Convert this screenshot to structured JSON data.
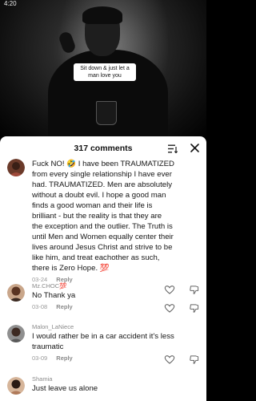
{
  "status_bar": {
    "time": "4:20",
    "right": ""
  },
  "video": {
    "caption": "Sit down & just let a man love you"
  },
  "comments_panel": {
    "title": "317 comments",
    "comments": [
      {
        "username": "",
        "text": "Fuck NO! 🤣 I have been TRAUMATIZED from every single relationship I have ever had. TRAUMATIZED. Men are absolutely without a doubt evil. I hope a good man finds a good woman and their life is brilliant - but the reality is that they are the exception and the outlier. The Truth is until Men and Women equally center their lives around Jesus Christ and strive to be like him, and treat eachother as such, there is Zero Hope. 💯",
        "date": "03-24",
        "reply": "Reply"
      },
      {
        "username": "Mz.CHOC💯",
        "text": "No Thank ya",
        "date": "03-08",
        "reply": "Reply"
      },
      {
        "username": "Malon_LaNiece",
        "text": "I would rather be in a car accident it's less traumatic",
        "date": "03-09",
        "reply": "Reply"
      },
      {
        "username": "Shamia",
        "text": "Just leave us alone",
        "date": "",
        "reply": ""
      }
    ]
  },
  "icons": {
    "sort": "sort-icon",
    "close": "close-icon",
    "like": "heart-outline-icon",
    "dislike": "thumbs-down-icon"
  },
  "colors": {
    "sheet_bg": "#ffffff",
    "text": "#151515",
    "muted": "#9a9a9a"
  }
}
